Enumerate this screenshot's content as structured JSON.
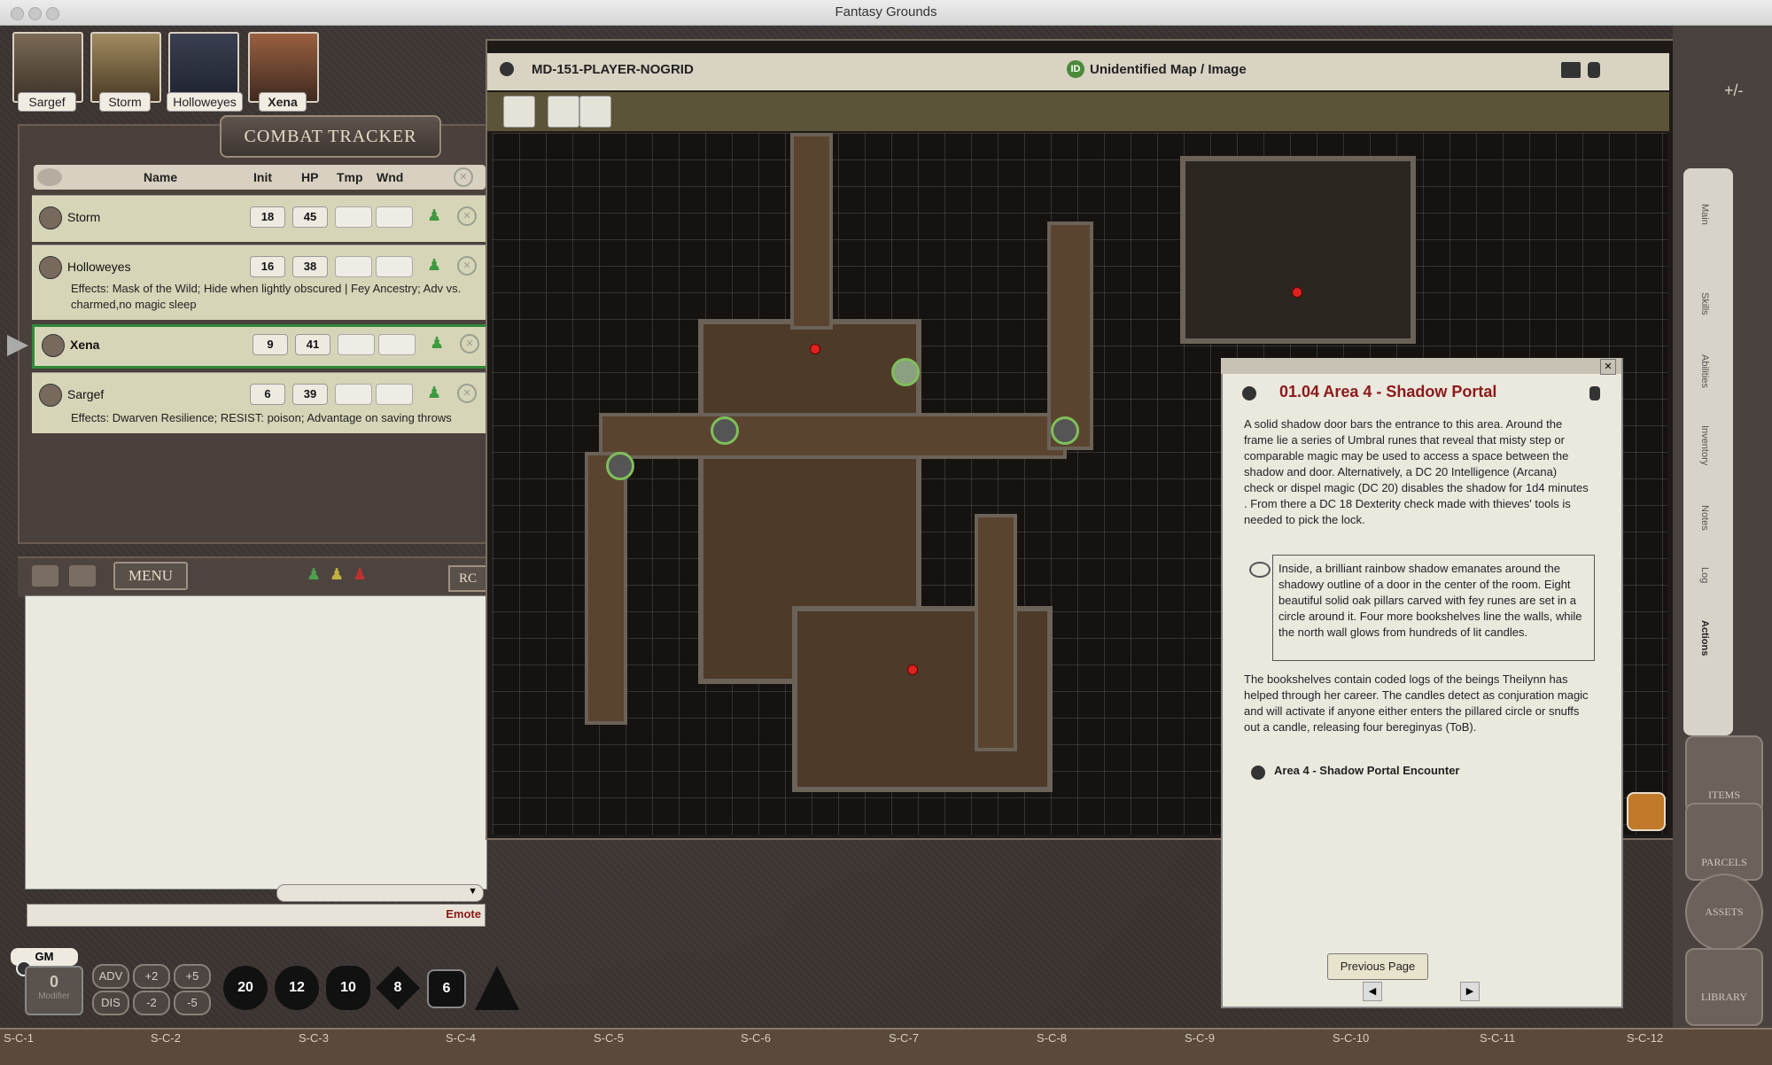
{
  "app_title": "Fantasy Grounds",
  "party": [
    {
      "name": "Sargef",
      "bold": false
    },
    {
      "name": "Storm",
      "bold": false
    },
    {
      "name": "Holloweyes",
      "bold": false
    },
    {
      "name": "Xena",
      "bold": true
    }
  ],
  "combat_tracker": {
    "title": "COMBAT TRACKER",
    "headers": {
      "name": "Name",
      "init": "Init",
      "hp": "HP",
      "tmp": "Tmp",
      "wnd": "Wnd"
    },
    "rows": [
      {
        "name": "Storm",
        "init": "18",
        "hp": "45",
        "effects": "",
        "active": false
      },
      {
        "name": "Holloweyes",
        "init": "16",
        "hp": "38",
        "effects": "Effects: Mask of the Wild; Hide when lightly obscured | Fey Ancestry; Adv vs. charmed,no magic sleep",
        "active": false
      },
      {
        "name": "Xena",
        "init": "9",
        "hp": "41",
        "effects": "",
        "active": true
      },
      {
        "name": "Sargef",
        "init": "6",
        "hp": "39",
        "effects": "Effects: Dwarven Resilience; RESIST: poison; Advantage on saving throws",
        "active": false
      }
    ]
  },
  "chat": {
    "menu_label": "MENU",
    "rc_label": "RC",
    "emote_label": "Emote"
  },
  "dice_bar": {
    "gm_label": "GM",
    "modifier_value": "0",
    "modifier_label": "Modifier",
    "adv": "ADV",
    "dis": "DIS",
    "plus2": "+2",
    "plus5": "+5",
    "minus2": "-2",
    "minus5": "-5",
    "dice": [
      "20",
      "12",
      "10",
      "8",
      "6"
    ]
  },
  "map": {
    "name": "MD-151-PLAYER-NOGRID",
    "kind": "Unidentified Map / Image",
    "id_badge": "ID"
  },
  "story": {
    "title": "01.04 Area 4 - Shadow Portal",
    "para1": "A solid shadow door bars the entrance to this area. Around the frame lie a series of Umbral runes that reveal that misty step or comparable magic may be used to access a space between the shadow and door. Alternatively, a DC 20 Intelligence (Arcana) check or dispel magic (DC 20) disables the shadow for 1d4 minutes . From there a DC 18 Dexterity check made with thieves' tools is needed to pick the lock.",
    "boxed": "Inside, a brilliant rainbow shadow emanates around the shadowy outline of a door in the center of the room. Eight beautiful solid oak pillars carved with fey runes are set in a circle around it. Four more bookshelves line the walls, while the north wall glows from hundreds of lit candles.",
    "para2": "The bookshelves contain coded logs of the beings Theilynn has helped through her career. The candles detect as conjuration magic and will activate if anyone either enters the pillared circle or snuffs out a candle, releasing four bereginyas (ToB).",
    "encounter_link": "Area 4 - Shadow Portal Encounter",
    "prev_page": "Previous Page"
  },
  "sidebar": {
    "tabs": [
      "Main",
      "Skills",
      "Abilities",
      "Inventory",
      "Notes",
      "Log",
      "Actions"
    ],
    "buttons": [
      "ITEMS",
      "PARCELS",
      "ASSETS",
      "LIBRARY"
    ],
    "plus_minus": "+/-"
  },
  "hotkeys": [
    "S-C-1",
    "S-C-2",
    "S-C-3",
    "S-C-4",
    "S-C-5",
    "S-C-6",
    "S-C-7",
    "S-C-8",
    "S-C-9",
    "S-C-10",
    "S-C-11",
    "S-C-12"
  ]
}
